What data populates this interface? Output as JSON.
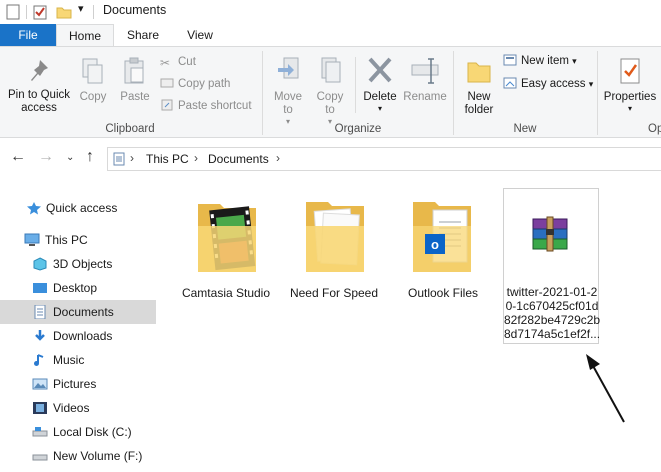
{
  "window": {
    "title": "Documents"
  },
  "ribbon_tabs": {
    "file": "File",
    "home": "Home",
    "share": "Share",
    "view": "View"
  },
  "ribbon": {
    "clipboard": {
      "pin_to_quick_access": "Pin to Quick access",
      "copy": "Copy",
      "paste": "Paste",
      "cut": "Cut",
      "copy_path": "Copy path",
      "paste_shortcut": "Paste shortcut",
      "label": "Clipboard"
    },
    "organize": {
      "move_to": "Move to",
      "copy_to": "Copy to",
      "delete": "Delete",
      "rename": "Rename",
      "label": "Organize"
    },
    "new": {
      "new_folder": "New folder",
      "new_item": "New item",
      "easy_access": "Easy access",
      "label": "New"
    },
    "open": {
      "properties": "Properties",
      "label_partial": "Op"
    }
  },
  "address_bar": {
    "crumbs": [
      "This PC",
      "Documents"
    ]
  },
  "nav_pane": {
    "items": [
      {
        "label": "Quick access",
        "icon": "star-icon"
      },
      {
        "label": "This PC",
        "icon": "computer-icon"
      },
      {
        "label": "3D Objects",
        "icon": "cube-icon"
      },
      {
        "label": "Desktop",
        "icon": "desktop-icon"
      },
      {
        "label": "Documents",
        "icon": "document-icon"
      },
      {
        "label": "Downloads",
        "icon": "download-icon"
      },
      {
        "label": "Music",
        "icon": "music-icon"
      },
      {
        "label": "Pictures",
        "icon": "picture-icon"
      },
      {
        "label": "Videos",
        "icon": "video-icon"
      },
      {
        "label": "Local Disk (C:)",
        "icon": "drive-icon"
      },
      {
        "label": "New Volume (F:)",
        "icon": "drive-icon"
      }
    ]
  },
  "files": [
    {
      "name": "Camtasia Studio",
      "icon": "folder-video-icon"
    },
    {
      "name": "Need For Speed",
      "icon": "folder-icon"
    },
    {
      "name": "Outlook Files",
      "icon": "folder-outlook-icon"
    },
    {
      "name_lines": [
        "twitter-2021-01-2",
        "0-1c670425cf01d",
        "82f282be4729c2b",
        "8d7174a5c1ef2f..."
      ],
      "icon": "winrar-archive-icon"
    }
  ],
  "colors": {
    "accent": "#1a73c8",
    "folder": "#f8d775",
    "selected": "#d9d9d9"
  }
}
